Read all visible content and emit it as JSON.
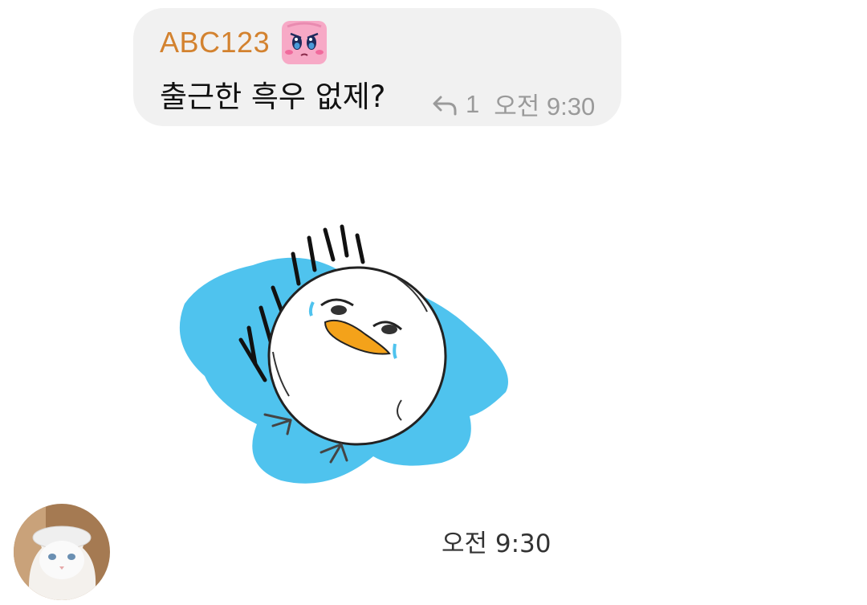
{
  "message": {
    "sender": "ABC123",
    "text": "출근한 흑우 없제?",
    "reply_count": "1",
    "time": "오전 9:30",
    "sender_color": "#d3822f",
    "bubble_color": "#f1f1f1",
    "sender_badge_icon": "pink-puffball-face-icon"
  },
  "reply": {
    "sticker_name": "crying-duck-sticker",
    "time": "오전 9:30",
    "avatar_icon": "white-cat-avatar"
  }
}
